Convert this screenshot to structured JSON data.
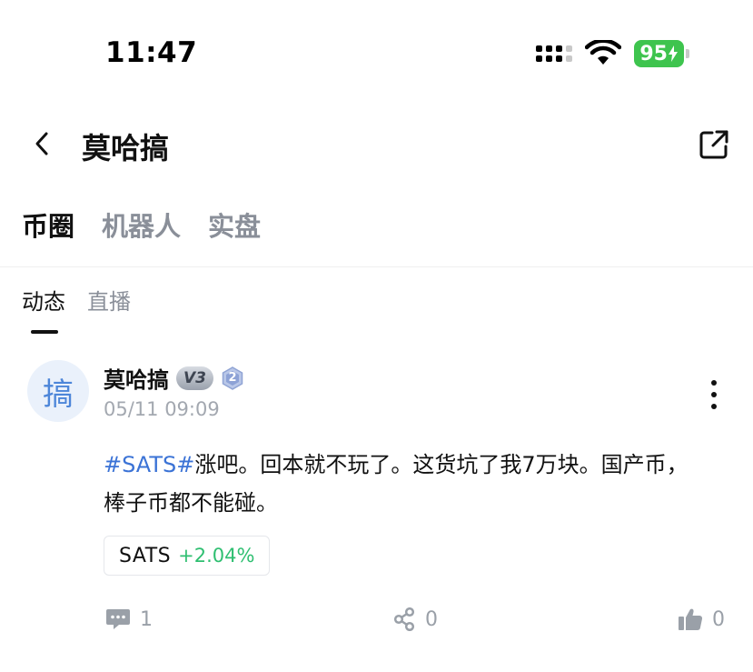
{
  "status_bar": {
    "time": "11:47",
    "battery": "95",
    "icons": [
      "signal-icon",
      "wifi-icon",
      "battery-charging-icon"
    ]
  },
  "nav": {
    "title": "莫哈搞",
    "back_icon": "chevron-left-icon",
    "share_icon": "share-external-icon"
  },
  "main_tabs": [
    {
      "label": "币圈",
      "active": true
    },
    {
      "label": "机器人",
      "active": false
    },
    {
      "label": "实盘",
      "active": false
    }
  ],
  "sub_tabs": [
    {
      "label": "动态",
      "active": true
    },
    {
      "label": "直播",
      "active": false
    }
  ],
  "post": {
    "avatar_char": "搞",
    "author": "莫哈搞",
    "vip_badge": "V3",
    "level": "2",
    "time": "05/11 09:09",
    "hashtag": "#SATS#",
    "text": "涨吧。回本就不玩了。这货坑了我7万块。国产币，棒子币都不能碰。",
    "coin": {
      "symbol": "SATS",
      "change": "+2.04%"
    },
    "actions": {
      "comments": "1",
      "shares": "0",
      "likes": "0"
    }
  },
  "colors": {
    "hashtag": "#3b73d6",
    "positive": "#2fbf71",
    "battery": "#3ec44e",
    "muted": "#8a8f99"
  }
}
